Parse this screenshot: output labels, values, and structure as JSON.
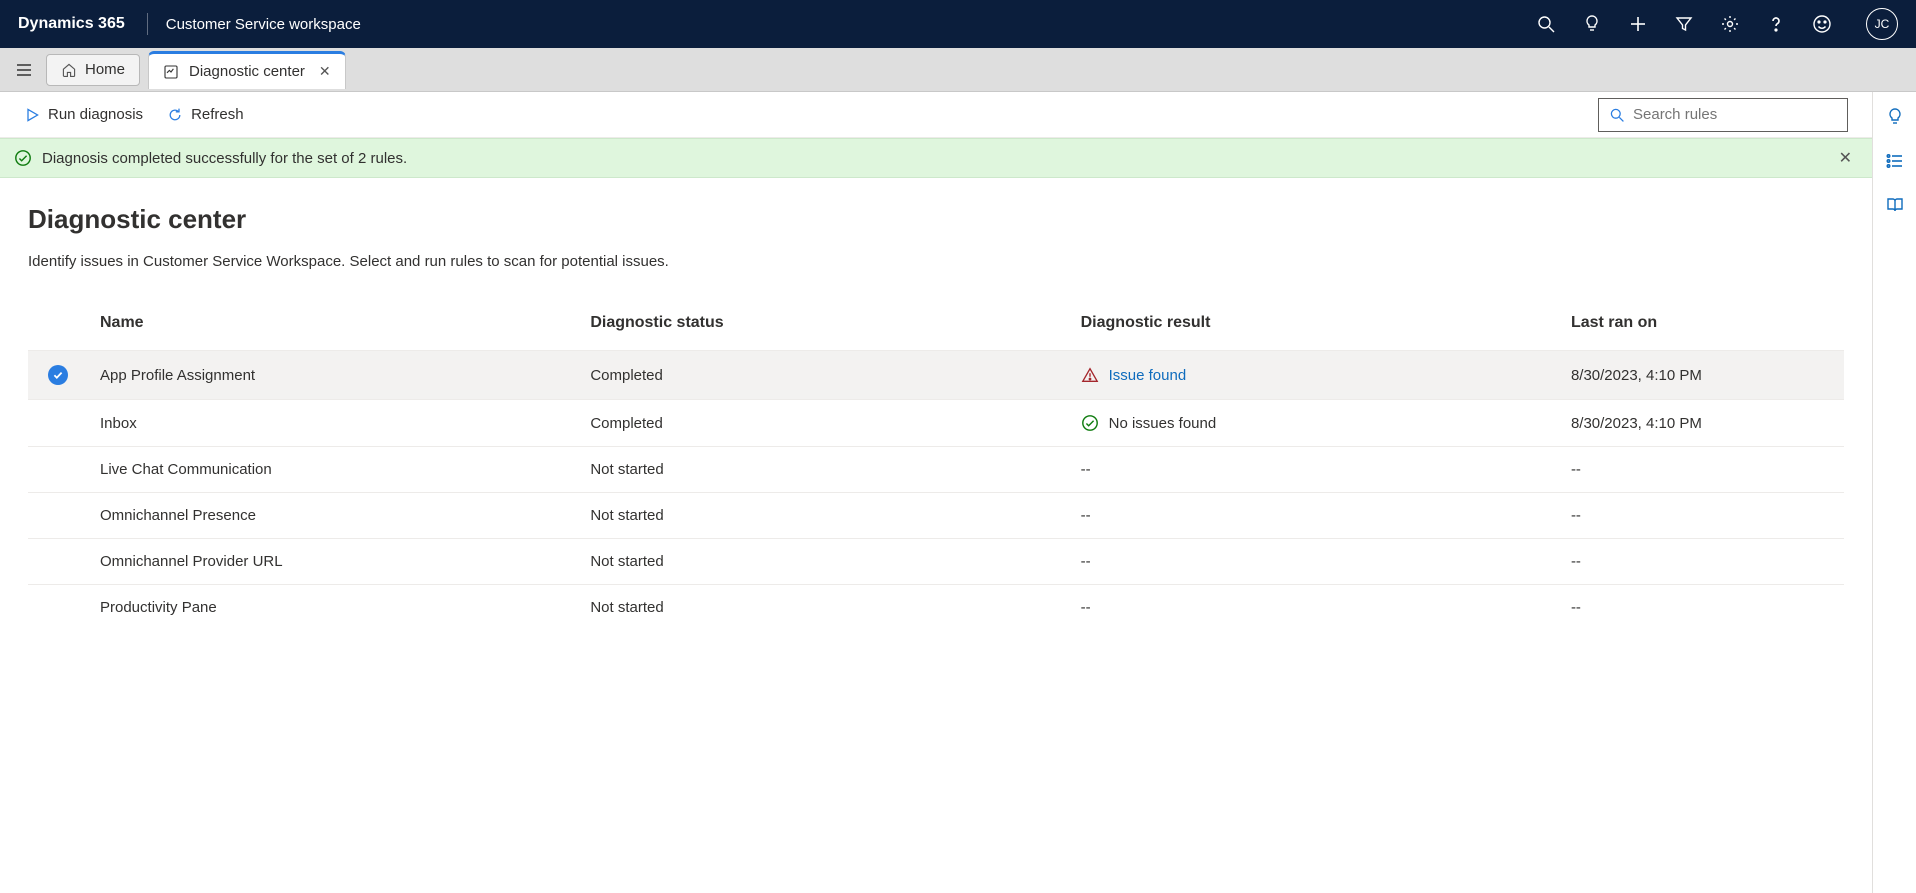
{
  "header": {
    "app_name": "Dynamics 365",
    "workspace_name": "Customer Service workspace",
    "avatar_initials": "JC"
  },
  "tabs": {
    "home_label": "Home",
    "active_label": "Diagnostic center"
  },
  "commands": {
    "run_diagnosis": "Run diagnosis",
    "refresh": "Refresh"
  },
  "search": {
    "placeholder": "Search rules"
  },
  "notification": {
    "message": "Diagnosis completed successfully for the set of 2 rules."
  },
  "page": {
    "title": "Diagnostic center",
    "desc": "Identify issues in Customer Service Workspace. Select and run rules to scan for potential issues."
  },
  "columns": {
    "name": "Name",
    "status": "Diagnostic status",
    "result": "Diagnostic result",
    "last_ran": "Last ran on"
  },
  "rows": [
    {
      "selected": true,
      "name": "App Profile Assignment",
      "status": "Completed",
      "result_type": "issue",
      "result": "Issue found",
      "last_ran": "8/30/2023, 4:10 PM"
    },
    {
      "selected": false,
      "name": "Inbox",
      "status": "Completed",
      "result_type": "ok",
      "result": "No issues found",
      "last_ran": "8/30/2023, 4:10 PM"
    },
    {
      "selected": false,
      "name": "Live Chat Communication",
      "status": "Not started",
      "result_type": "none",
      "result": "--",
      "last_ran": "--"
    },
    {
      "selected": false,
      "name": "Omnichannel Presence",
      "status": "Not started",
      "result_type": "none",
      "result": "--",
      "last_ran": "--"
    },
    {
      "selected": false,
      "name": "Omnichannel Provider URL",
      "status": "Not started",
      "result_type": "none",
      "result": "--",
      "last_ran": "--"
    },
    {
      "selected": false,
      "name": "Productivity Pane",
      "status": "Not started",
      "result_type": "none",
      "result": "--",
      "last_ran": "--"
    }
  ]
}
